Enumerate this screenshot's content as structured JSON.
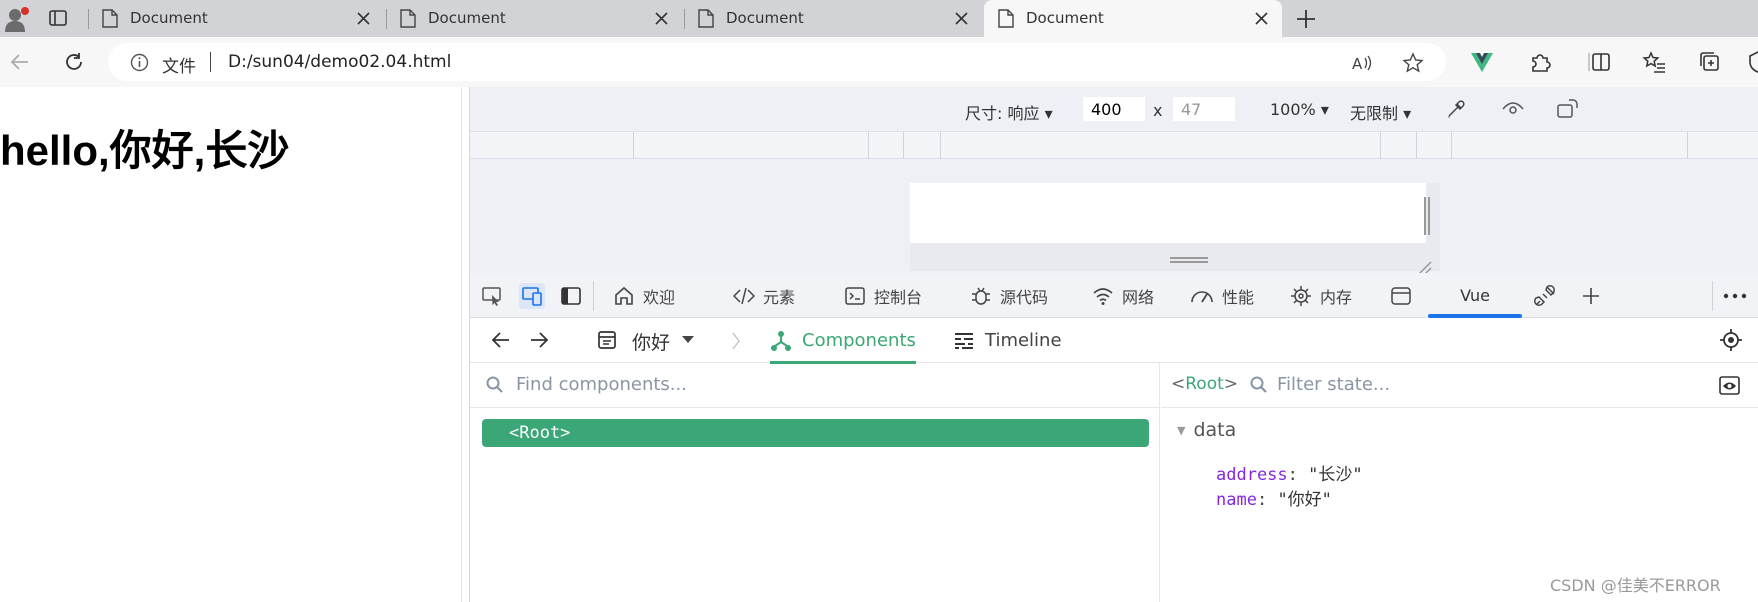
{
  "browser": {
    "tabs": [
      {
        "title": "Document"
      },
      {
        "title": "Document"
      },
      {
        "title": "Document"
      },
      {
        "title": "Document",
        "active": true
      }
    ],
    "address": {
      "file_label": "文件",
      "url": "D:/sun04/demo02.04.html"
    }
  },
  "page": {
    "heading": "hello,你好,长沙"
  },
  "devtools": {
    "device_bar": {
      "size_label": "尺寸: 响应",
      "width": "400",
      "x": "x",
      "height": "47",
      "zoom": "100%",
      "throttle": "无限制"
    },
    "tabs": [
      {
        "label": "欢迎",
        "icon": "home-icon"
      },
      {
        "label": "元素",
        "icon": "code-icon"
      },
      {
        "label": "控制台",
        "icon": "console-icon"
      },
      {
        "label": "源代码",
        "icon": "bug-icon"
      },
      {
        "label": "网络",
        "icon": "wifi-icon"
      },
      {
        "label": "性能",
        "icon": "gauge-icon"
      },
      {
        "label": "内存",
        "icon": "chip-icon"
      },
      {
        "label": "Vue",
        "active": true
      }
    ],
    "vue": {
      "app_name": "你好",
      "nav_tabs": [
        "Components",
        "Timeline"
      ],
      "find_placeholder": "Find components...",
      "root_label": "<Root>",
      "selected": "Root",
      "filter_placeholder": "Filter state...",
      "section": "data",
      "props": [
        {
          "key": "address",
          "value": "\"长沙\""
        },
        {
          "key": "name",
          "value": "\"你好\""
        }
      ]
    }
  },
  "watermark": "CSDN @佳美不ERROR",
  "colors": {
    "vue_green": "#3ba776",
    "accent_blue": "#1a73e8",
    "prop_key": "#8628dc"
  }
}
